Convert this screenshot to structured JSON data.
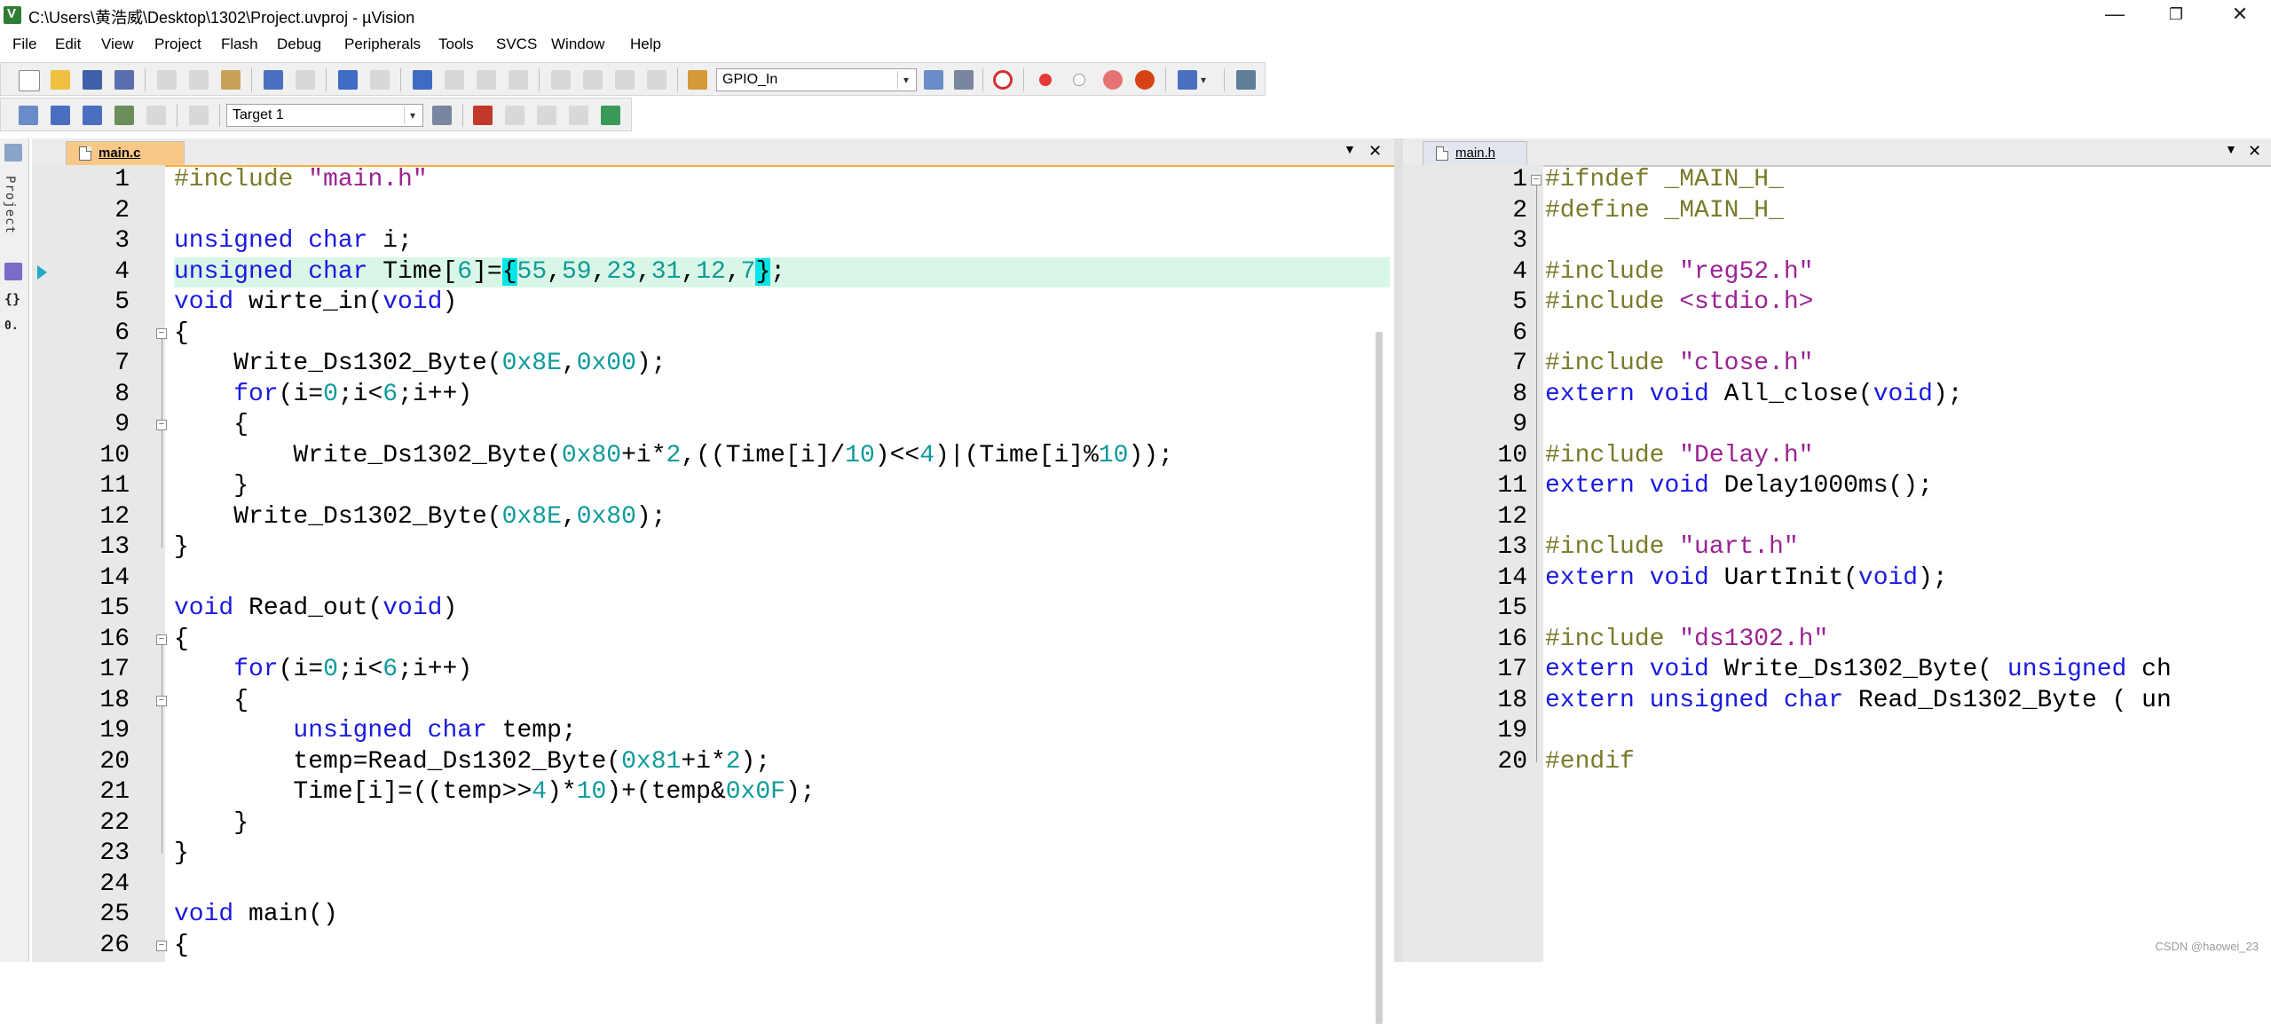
{
  "window": {
    "title": "C:\\Users\\黄浩威\\Desktop\\1302\\Project.uvproj - µVision",
    "minimize": "—",
    "maximize": "❐",
    "close": "✕"
  },
  "menu": [
    "File",
    "Edit",
    "View",
    "Project",
    "Flash",
    "Debug",
    "Peripherals",
    "Tools",
    "SVCS",
    "Window",
    "Help"
  ],
  "toolbar": {
    "find_combo": "GPIO_In",
    "target_combo": "Target 1",
    "accent_colors": {
      "breakpoint": "#e53935",
      "tab_underline": "#f5b041"
    }
  },
  "left_panel": {
    "label": "Project"
  },
  "editor_left": {
    "tab": "main.c",
    "current_line": 4,
    "lines": [
      {
        "n": "1",
        "t": "#include \"main.h\""
      },
      {
        "n": "2",
        "t": ""
      },
      {
        "n": "3",
        "t": "unsigned char i;"
      },
      {
        "n": "4",
        "t": "unsigned char Time[6]={55,59,23,31,12,7};"
      },
      {
        "n": "5",
        "t": "void wirte_in(void)"
      },
      {
        "n": "6",
        "t": "{"
      },
      {
        "n": "7",
        "t": "    Write_Ds1302_Byte(0x8E,0x00);"
      },
      {
        "n": "8",
        "t": "    for(i=0;i<6;i++)"
      },
      {
        "n": "9",
        "t": "    {"
      },
      {
        "n": "10",
        "t": "        Write_Ds1302_Byte(0x80+i*2,((Time[i]/10)<<4)|(Time[i]%10));"
      },
      {
        "n": "11",
        "t": "    }"
      },
      {
        "n": "12",
        "t": "    Write_Ds1302_Byte(0x8E,0x80);"
      },
      {
        "n": "13",
        "t": "}"
      },
      {
        "n": "14",
        "t": ""
      },
      {
        "n": "15",
        "t": "void Read_out(void)"
      },
      {
        "n": "16",
        "t": "{"
      },
      {
        "n": "17",
        "t": "    for(i=0;i<6;i++)"
      },
      {
        "n": "18",
        "t": "    {"
      },
      {
        "n": "19",
        "t": "        unsigned char temp;"
      },
      {
        "n": "20",
        "t": "        temp=Read_Ds1302_Byte(0x81+i*2);"
      },
      {
        "n": "21",
        "t": "        Time[i]=((temp>>4)*10)+(temp&0x0F);"
      },
      {
        "n": "22",
        "t": "    }"
      },
      {
        "n": "23",
        "t": "}"
      },
      {
        "n": "24",
        "t": ""
      },
      {
        "n": "25",
        "t": "void main()"
      },
      {
        "n": "26",
        "t": "{"
      }
    ]
  },
  "editor_right": {
    "tab": "main.h",
    "lines": [
      {
        "n": "1",
        "t": "#ifndef _MAIN_H_"
      },
      {
        "n": "2",
        "t": "#define _MAIN_H_"
      },
      {
        "n": "3",
        "t": ""
      },
      {
        "n": "4",
        "t": "#include \"reg52.h\""
      },
      {
        "n": "5",
        "t": "#include <stdio.h>"
      },
      {
        "n": "6",
        "t": ""
      },
      {
        "n": "7",
        "t": "#include \"close.h\""
      },
      {
        "n": "8",
        "t": "extern void All_close(void);"
      },
      {
        "n": "9",
        "t": ""
      },
      {
        "n": "10",
        "t": "#include \"Delay.h\""
      },
      {
        "n": "11",
        "t": "extern void Delay1000ms();"
      },
      {
        "n": "12",
        "t": ""
      },
      {
        "n": "13",
        "t": "#include \"uart.h\""
      },
      {
        "n": "14",
        "t": "extern void UartInit(void);"
      },
      {
        "n": "15",
        "t": ""
      },
      {
        "n": "16",
        "t": "#include \"ds1302.h\""
      },
      {
        "n": "17",
        "t": "extern void Write_Ds1302_Byte( unsigned ch"
      },
      {
        "n": "18",
        "t": "extern unsigned char Read_Ds1302_Byte ( un"
      },
      {
        "n": "19",
        "t": ""
      },
      {
        "n": "20",
        "t": "#endif"
      }
    ]
  },
  "watermark": "CSDN @haowei_23"
}
